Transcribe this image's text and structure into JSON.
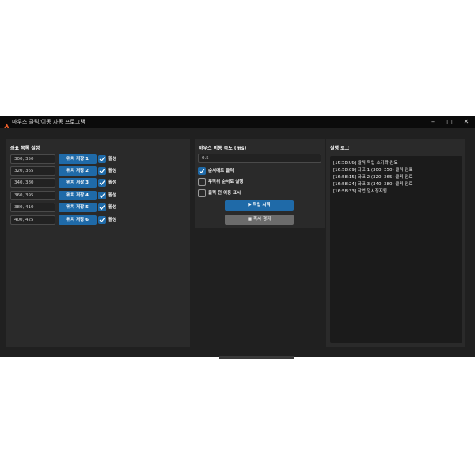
{
  "window": {
    "title": "마우스 클릭/이동 자동 프로그램",
    "minimize_icon": "minimize-icon",
    "maximize_icon": "maximize-icon",
    "close_icon": "close-icon"
  },
  "coords_panel": {
    "title": "좌표 목록 설정",
    "rows": [
      {
        "value": "300, 350",
        "save_label": "위치 저장 1",
        "active_label": "활성",
        "checked": true
      },
      {
        "value": "320, 365",
        "save_label": "위치 저장 2",
        "active_label": "활성",
        "checked": true
      },
      {
        "value": "340, 380",
        "save_label": "위치 저장 3",
        "active_label": "활성",
        "checked": true
      },
      {
        "value": "360, 395",
        "save_label": "위치 저장 4",
        "active_label": "활성",
        "checked": true
      },
      {
        "value": "380, 410",
        "save_label": "위치 저장 5",
        "active_label": "활성",
        "checked": true
      },
      {
        "value": "400, 425",
        "save_label": "위치 저장 6",
        "active_label": "활성",
        "checked": true
      }
    ]
  },
  "settings_panel": {
    "speed_label": "마우스 이동 속도 (ms)",
    "speed_value": "0.5",
    "options": [
      {
        "label": "순서대로 클릭",
        "checked": true
      },
      {
        "label": "무작위 순서로 실행",
        "checked": false
      },
      {
        "label": "클릭 전 이동 표시",
        "checked": false
      }
    ],
    "run_label": "▶ 작업 시작",
    "stop_label": "■ 즉시 정지"
  },
  "log_panel": {
    "title": "실행 로그",
    "lines": [
      "[16:58:06] 클릭 작업 초기화 완료",
      "[16:58:09] 좌표 1 (300, 350) 클릭 완료",
      "[16:58:15] 좌표 2 (320, 365) 클릭 완료",
      "[16:58:24] 좌표 3 (340, 380) 클릭 완료",
      "[16:58:33] 작업 일시정지됨"
    ]
  },
  "colors": {
    "accent": "#1f6aa8",
    "window_bg": "#202020",
    "panel_bg": "#2a2a2a",
    "titlebar_bg": "#0b0b0b"
  }
}
